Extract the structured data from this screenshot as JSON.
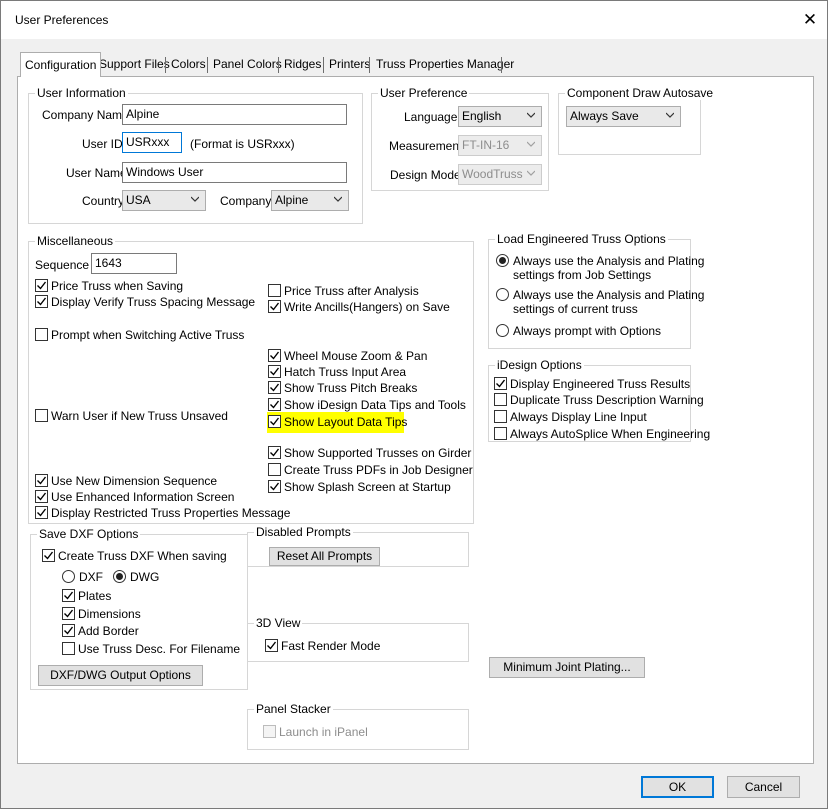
{
  "window": {
    "title": "User Preferences",
    "close_glyph": "✕"
  },
  "tabs": [
    "Configuration",
    "Support Files",
    "Colors",
    "Panel Colors",
    "Ridges",
    "Printers",
    "Truss Properties Manager"
  ],
  "user_info": {
    "label": "User Information",
    "company_name_label": "Company Name",
    "company_name": "Alpine",
    "user_id_label": "User ID",
    "user_id": "USRxxx",
    "user_id_hint": "(Format is USRxxx)",
    "user_name_label": "User Name",
    "user_name": "Windows User",
    "country_label": "Country",
    "country": "USA",
    "company_label": "Company",
    "company": "Alpine"
  },
  "user_pref": {
    "label": "User Preference",
    "language_label": "Language",
    "language": "English",
    "measurement_label": "Measurement",
    "measurement": "FT-IN-16",
    "design_mode_label": "Design Mode",
    "design_mode": "WoodTruss"
  },
  "autosave": {
    "label": "Component Draw Autosave",
    "value": "Always Save"
  },
  "misc": {
    "label": "Miscellaneous",
    "sequence_label": "Sequence",
    "sequence": "1643",
    "left_top": [
      {
        "label": "Price Truss when Saving",
        "checked": true
      },
      {
        "label": "Display Verify Truss Spacing Message",
        "checked": true
      }
    ],
    "prompt_switch": {
      "label": "Prompt when Switching Active Truss",
      "checked": false
    },
    "warn_unsaved": {
      "label": "Warn User if New Truss Unsaved",
      "checked": false
    },
    "left_bottom": [
      {
        "label": "Use New Dimension Sequence",
        "checked": true
      },
      {
        "label": "Use Enhanced Information Screen",
        "checked": true
      },
      {
        "label": "Display Restricted Truss Properties Message",
        "checked": true
      }
    ],
    "right_top": [
      {
        "label": "Price Truss after Analysis",
        "checked": false
      },
      {
        "label": "Write Ancills(Hangers) on Save",
        "checked": true
      }
    ],
    "right_mid": [
      {
        "label": "Wheel Mouse Zoom & Pan",
        "checked": true
      },
      {
        "label": "Hatch Truss Input Area",
        "checked": true
      },
      {
        "label": "Show Truss Pitch Breaks",
        "checked": true
      },
      {
        "label": "Show iDesign Data Tips and Tools",
        "checked": true
      },
      {
        "label": "Show Layout Data Tips",
        "checked": true
      }
    ],
    "right_bottom": [
      {
        "label": "Show Supported Trusses on Girder",
        "checked": true
      },
      {
        "label": "Create Truss PDFs in Job Designer",
        "checked": false
      },
      {
        "label": "Show Splash Screen at Startup",
        "checked": true
      }
    ]
  },
  "load_eng": {
    "label": "Load Engineered Truss Options",
    "options": [
      {
        "label": "Always use the Analysis and Plating",
        "label2": "settings from Job Settings",
        "selected": true
      },
      {
        "label": "Always use the Analysis and Plating",
        "label2": "settings of current truss",
        "selected": false
      },
      {
        "label": "Always prompt with Options",
        "label2": "",
        "selected": false
      }
    ]
  },
  "idesign": {
    "label": "iDesign Options",
    "items": [
      {
        "label": "Display Engineered Truss Results",
        "checked": true
      },
      {
        "label": "Duplicate Truss Description Warning",
        "checked": false
      },
      {
        "label": "Always Display Line Input",
        "checked": false
      },
      {
        "label": "Always AutoSplice When Engineering",
        "checked": false
      }
    ]
  },
  "dxf": {
    "label": "Save DXF Options",
    "create": {
      "label": "Create Truss DXF When saving",
      "checked": true
    },
    "format_dxf": "DXF",
    "format_dwg": "DWG",
    "selected_format": "DWG",
    "items": [
      {
        "label": "Plates",
        "checked": true
      },
      {
        "label": "Dimensions",
        "checked": true
      },
      {
        "label": "Add Border",
        "checked": true
      },
      {
        "label": "Use Truss Desc. For Filename",
        "checked": false
      }
    ],
    "output_button": "DXF/DWG Output Options"
  },
  "disabled_prompts": {
    "label": "Disabled Prompts",
    "button": "Reset All Prompts"
  },
  "view3d": {
    "label": "3D View",
    "fast_render": {
      "label": "Fast Render Mode",
      "checked": true
    }
  },
  "panel_stacker": {
    "label": "Panel Stacker",
    "launch": {
      "label": "Launch in iPanel",
      "checked": false
    }
  },
  "min_joint_button": "Minimum Joint Plating...",
  "ok_button": "OK",
  "cancel_button": "Cancel",
  "colors": {
    "highlight": "#ffff00",
    "focus_border": "#0078d7"
  }
}
